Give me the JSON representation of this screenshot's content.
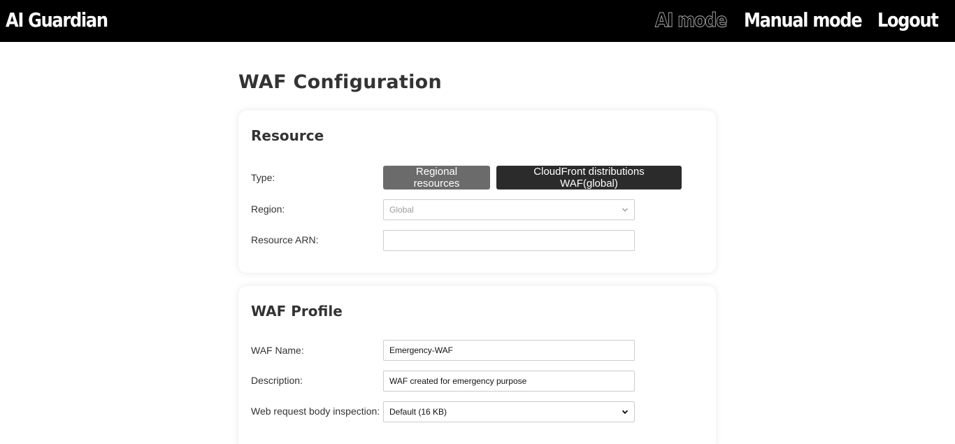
{
  "header": {
    "brand": "AI Guardian",
    "nav": {
      "ai_mode": "AI mode",
      "manual_mode": "Manual mode",
      "logout": "Logout"
    }
  },
  "page": {
    "title": "WAF Configuration"
  },
  "resource": {
    "title": "Resource",
    "type_label": "Type:",
    "type_options": [
      "Regional resources",
      "CloudFront distributions WAF(global)"
    ],
    "type_selected": "CloudFront distributions WAF(global)",
    "region_label": "Region:",
    "region_value": "Global",
    "arn_label": "Resource ARN:",
    "arn_value": ""
  },
  "profile": {
    "title": "WAF Profile",
    "name_label": "WAF Name:",
    "name_value": "Emergency-WAF",
    "description_label": "Description:",
    "description_value": "WAF created for emergency purpose",
    "body_inspection_label": "Web request body inspection:",
    "body_inspection_value": "Default (16 KB)"
  },
  "colors": {
    "header_bg": "#000000",
    "regional_button": "#6b6b6b",
    "cloudfront_button": "#2b2b2b"
  }
}
